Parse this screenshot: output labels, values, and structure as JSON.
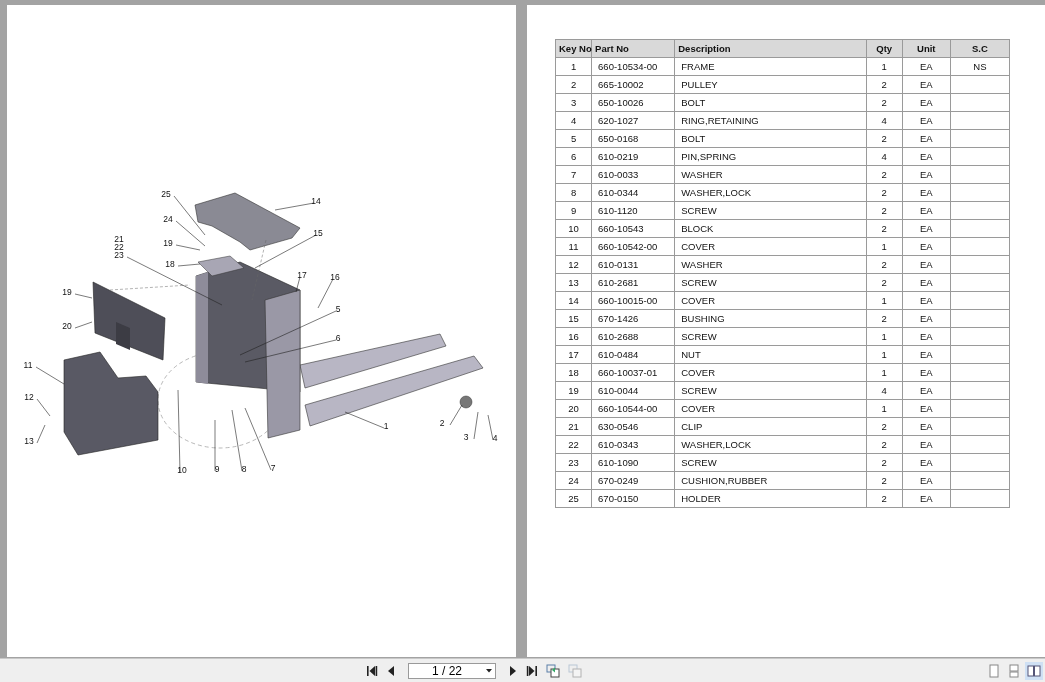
{
  "left_page": {
    "drawing": {
      "callouts": [
        "25",
        "14",
        "24",
        "15",
        "21",
        "22",
        "23",
        "19",
        "18",
        "17",
        "16",
        "19",
        "5",
        "20",
        "6",
        "11",
        "12",
        "13",
        "2",
        "1",
        "3",
        "4",
        "10",
        "9",
        "8",
        "7"
      ]
    }
  },
  "right_page": {
    "table": {
      "columns": [
        "Key No",
        "Part No",
        "Description",
        "Qty",
        "Unit",
        "S.C"
      ],
      "rows": [
        {
          "key_no": "1",
          "part_no": "660-10534-00",
          "description": "FRAME",
          "qty": "1",
          "unit": "EA",
          "sc": "NS"
        },
        {
          "key_no": "2",
          "part_no": "665-10002",
          "description": "PULLEY",
          "qty": "2",
          "unit": "EA"
        },
        {
          "key_no": "3",
          "part_no": "650-10026",
          "description": "BOLT",
          "qty": "2",
          "unit": "EA"
        },
        {
          "key_no": "4",
          "part_no": "620-1027",
          "description": "RING,RETAINING",
          "qty": "4",
          "unit": "EA"
        },
        {
          "key_no": "5",
          "part_no": "650-0168",
          "description": "BOLT",
          "qty": "2",
          "unit": "EA"
        },
        {
          "key_no": "6",
          "part_no": "610-0219",
          "description": "PIN,SPRING",
          "qty": "4",
          "unit": "EA"
        },
        {
          "key_no": "7",
          "part_no": "610-0033",
          "description": "WASHER",
          "qty": "2",
          "unit": "EA"
        },
        {
          "key_no": "8",
          "part_no": "610-0344",
          "description": "WASHER,LOCK",
          "qty": "2",
          "unit": "EA"
        },
        {
          "key_no": "9",
          "part_no": "610-1120",
          "description": "SCREW",
          "qty": "2",
          "unit": "EA"
        },
        {
          "key_no": "10",
          "part_no": "660-10543",
          "description": "BLOCK",
          "qty": "2",
          "unit": "EA"
        },
        {
          "key_no": "11",
          "part_no": "660-10542-00",
          "description": "COVER",
          "qty": "1",
          "unit": "EA"
        },
        {
          "key_no": "12",
          "part_no": "610-0131",
          "description": "WASHER",
          "qty": "2",
          "unit": "EA"
        },
        {
          "key_no": "13",
          "part_no": "610-2681",
          "description": "SCREW",
          "qty": "2",
          "unit": "EA"
        },
        {
          "key_no": "14",
          "part_no": "660-10015-00",
          "description": "COVER",
          "qty": "1",
          "unit": "EA"
        },
        {
          "key_no": "15",
          "part_no": "670-1426",
          "description": "BUSHING",
          "qty": "2",
          "unit": "EA"
        },
        {
          "key_no": "16",
          "part_no": "610-2688",
          "description": "SCREW",
          "qty": "1",
          "unit": "EA"
        },
        {
          "key_no": "17",
          "part_no": "610-0484",
          "description": "NUT",
          "qty": "1",
          "unit": "EA"
        },
        {
          "key_no": "18",
          "part_no": "660-10037-01",
          "description": "COVER",
          "qty": "1",
          "unit": "EA"
        },
        {
          "key_no": "19",
          "part_no": "610-0044",
          "description": "SCREW",
          "qty": "4",
          "unit": "EA"
        },
        {
          "key_no": "20",
          "part_no": "660-10544-00",
          "description": "COVER",
          "qty": "1",
          "unit": "EA"
        },
        {
          "key_no": "21",
          "part_no": "630-0546",
          "description": "CLIP",
          "qty": "2",
          "unit": "EA"
        },
        {
          "key_no": "22",
          "part_no": "610-0343",
          "description": "WASHER,LOCK",
          "qty": "2",
          "unit": "EA"
        },
        {
          "key_no": "23",
          "part_no": "610-1090",
          "description": "SCREW",
          "qty": "2",
          "unit": "EA"
        },
        {
          "key_no": "24",
          "part_no": "670-0249",
          "description": "CUSHION,RUBBER",
          "qty": "2",
          "unit": "EA"
        },
        {
          "key_no": "25",
          "part_no": "670-0150",
          "description": "HOLDER",
          "qty": "2",
          "unit": "EA"
        }
      ]
    }
  },
  "toolbar": {
    "page_field": {
      "value": "1 / 22"
    },
    "disabled_button": {
      "disabled": true
    },
    "view_modes": [
      {
        "selected": false
      },
      {
        "selected": false
      },
      {
        "selected": true
      }
    ]
  }
}
